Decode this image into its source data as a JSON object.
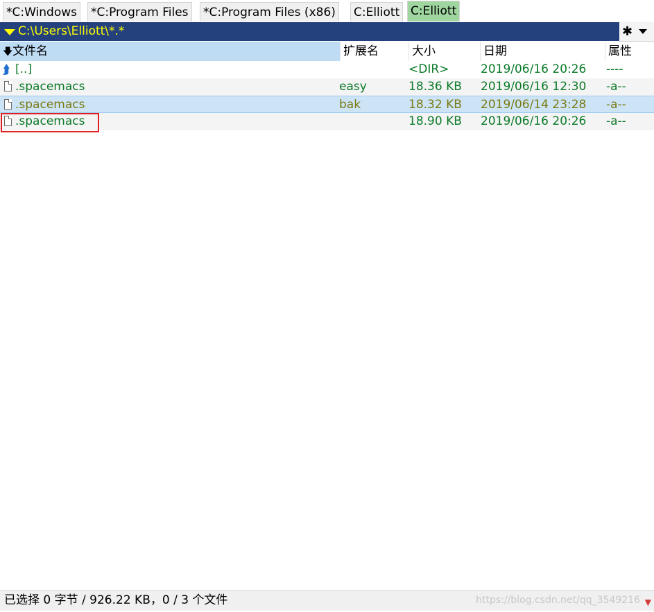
{
  "tabs": [
    {
      "label": "*C:Windows",
      "active": false
    },
    {
      "label": "*C:Program Files",
      "active": false
    },
    {
      "label": "*C:Program Files (x86)",
      "active": false
    },
    {
      "label": "C:Elliott",
      "active": false
    },
    {
      "label": "C:Elliott",
      "active": true
    }
  ],
  "path_bar": {
    "path": "C:\\Users\\Elliott\\*.*",
    "star_icon": "✱"
  },
  "columns": {
    "name": "文件名",
    "ext": "扩展名",
    "size": "大小",
    "date": "日期",
    "attr": "属性"
  },
  "files": [
    {
      "icon": "up-folder-icon",
      "name": "[..]",
      "ext": "",
      "size": "<DIR>",
      "date": "2019/06/16 20:26",
      "attr": "----"
    },
    {
      "icon": "file-icon",
      "name": ".spacemacs",
      "ext": "easy",
      "size": "18.36 KB",
      "date": "2019/06/16 12:30",
      "attr": "-a--"
    },
    {
      "icon": "file-icon",
      "name": ".spacemacs",
      "ext": "bak",
      "size": "18.32 KB",
      "date": "2019/06/14 23:28",
      "attr": "-a--"
    },
    {
      "icon": "file-icon",
      "name": ".spacemacs",
      "ext": "",
      "size": "18.90 KB",
      "date": "2019/06/16 20:26",
      "attr": "-a--"
    }
  ],
  "status": {
    "text": "已选择 0 字节 / 926.22 KB，0 / 3 个文件",
    "watermark": "https://blog.csdn.net/qq_3549216"
  },
  "colors": {
    "path_bg": "#24417e",
    "path_text": "#ffff00",
    "active_tab": "#9fd59f",
    "file_green": "#0b7a28",
    "file_olive": "#7a7a10",
    "highlight_box": "#e02020"
  }
}
